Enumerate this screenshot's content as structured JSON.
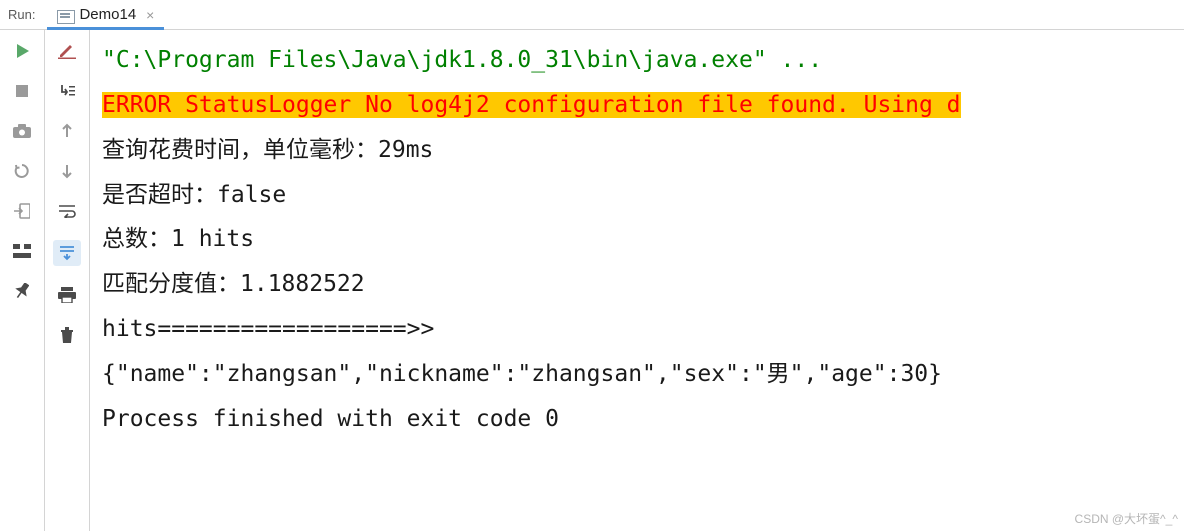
{
  "header": {
    "label": "Run:",
    "tab_name": "Demo14"
  },
  "console": {
    "line1": "\"C:\\Program Files\\Java\\jdk1.8.0_31\\bin\\java.exe\" ...",
    "line2": "ERROR StatusLogger No log4j2 configuration file found. Using d",
    "line3": "查询花费时间，单位毫秒：29ms",
    "line4": "是否超时：false",
    "line5": "总数：1 hits",
    "line6": "匹配分度值：1.1882522",
    "line7": "hits==================>>",
    "line8": "{\"name\":\"zhangsan\",\"nickname\":\"zhangsan\",\"sex\":\"男\",\"age\":30}",
    "line9": "",
    "line10": "Process finished with exit code 0"
  },
  "watermark": "CSDN @大坏蛋^_^"
}
